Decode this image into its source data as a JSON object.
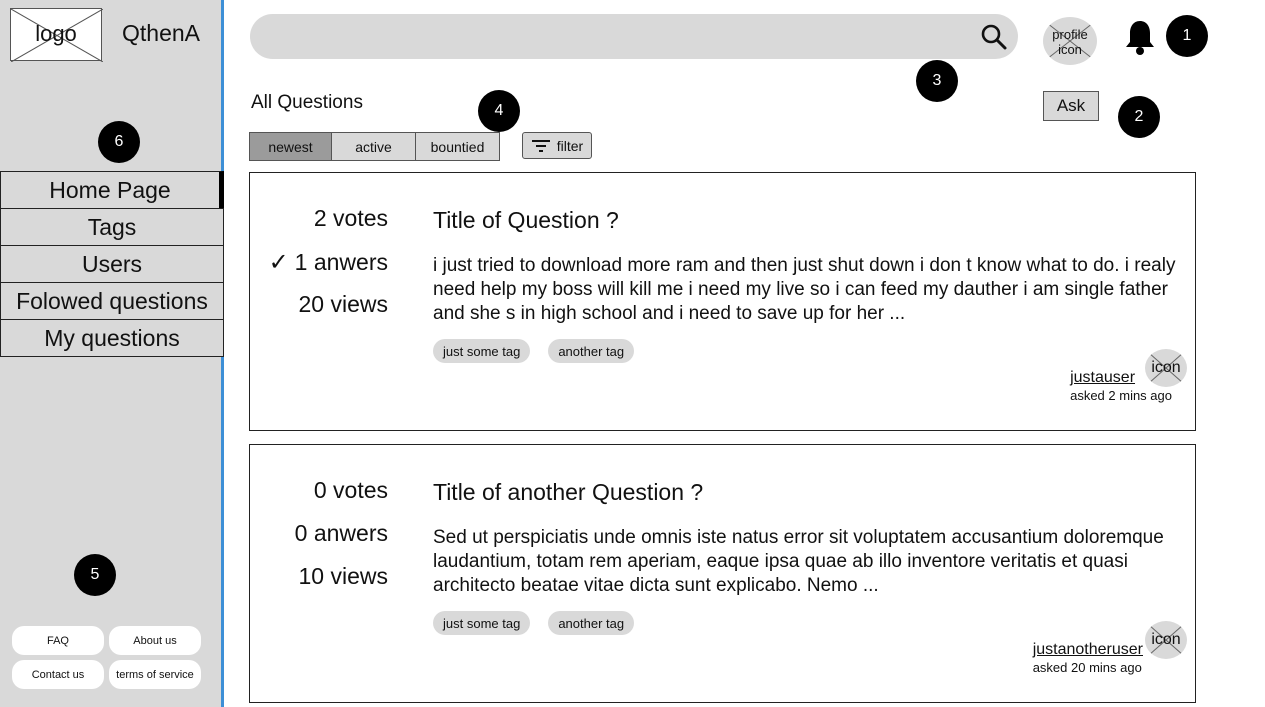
{
  "brand": {
    "logo_text": "logo",
    "app_name": "QthenA"
  },
  "markers": {
    "m1": "1",
    "m2": "2",
    "m3": "3",
    "m4": "4",
    "m5": "5",
    "m6": "6"
  },
  "sidebar": {
    "items": [
      {
        "label": "Home Page"
      },
      {
        "label": "Tags"
      },
      {
        "label": "Users"
      },
      {
        "label": "Folowed questions"
      },
      {
        "label": "My questions"
      }
    ],
    "footer": [
      {
        "label": "FAQ"
      },
      {
        "label": "About us"
      },
      {
        "label": "Contact us"
      },
      {
        "label": "terms of service"
      }
    ]
  },
  "header": {
    "search_value": "",
    "profile_icon_text": "profile icon"
  },
  "main": {
    "title": "All Questions",
    "ask_label": "Ask",
    "sort_tabs": [
      {
        "label": "newest"
      },
      {
        "label": "active"
      },
      {
        "label": "bountied"
      }
    ],
    "filter_label": "filter"
  },
  "questions": [
    {
      "votes": "2 votes",
      "answers": "1 anwers",
      "answered": true,
      "views": "20 views",
      "title": "Title of Question ?",
      "body": "i just tried to download more ram and then just shut down i don t  know what to do. i realy need help my boss will kill me i need my live so i can feed my dauther i am single father and she s in high school and i need to save up for her ...",
      "tags": [
        "just some tag",
        "another tag"
      ],
      "author": "justauser",
      "asked": "asked 2 mins ago",
      "icon_text": "icon"
    },
    {
      "votes": "0 votes",
      "answers": "0 anwers",
      "answered": false,
      "views": "10 views",
      "title": "Title of another Question ?",
      "body": "Sed ut perspiciatis unde omnis iste natus error sit voluptatem accusantium doloremque laudantium, totam rem aperiam, eaque ipsa quae ab illo inventore veritatis et quasi architecto beatae vitae dicta sunt explicabo. Nemo  ...",
      "tags": [
        "just some tag",
        "another tag"
      ],
      "author": "justanotheruser",
      "asked": "asked 20 mins ago",
      "icon_text": "icon"
    }
  ]
}
